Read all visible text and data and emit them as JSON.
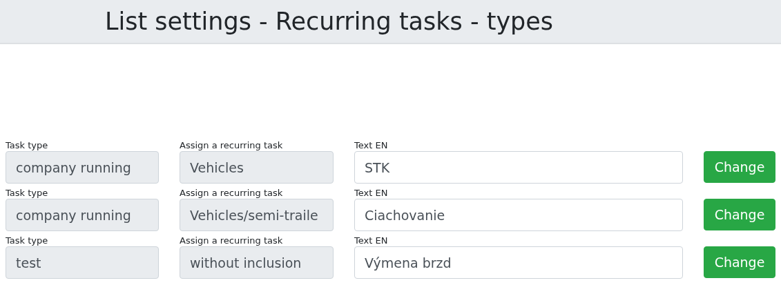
{
  "header": {
    "title": "List settings - Recurring tasks - types"
  },
  "rows": [
    {
      "fields": [
        {
          "label": "Task type",
          "value": "company running",
          "disabled": true
        },
        {
          "label": "Assign a recurring task",
          "value": "Vehicles",
          "disabled": true
        },
        {
          "label": "Text EN",
          "value": "STK",
          "disabled": false
        }
      ],
      "button": "Change"
    },
    {
      "fields": [
        {
          "label": "Task type",
          "value": "company running",
          "disabled": true
        },
        {
          "label": "Assign a recurring task",
          "value": "Vehicles/semi-traile",
          "disabled": true
        },
        {
          "label": "Text EN",
          "value": "Ciachovanie",
          "disabled": false
        }
      ],
      "button": "Change"
    },
    {
      "fields": [
        {
          "label": "Task type",
          "value": "test",
          "disabled": true
        },
        {
          "label": "Assign a recurring task",
          "value": "without inclusion",
          "disabled": true
        },
        {
          "label": "Text EN",
          "value": "Výmena brzd",
          "disabled": false
        }
      ],
      "button": "Change"
    }
  ]
}
